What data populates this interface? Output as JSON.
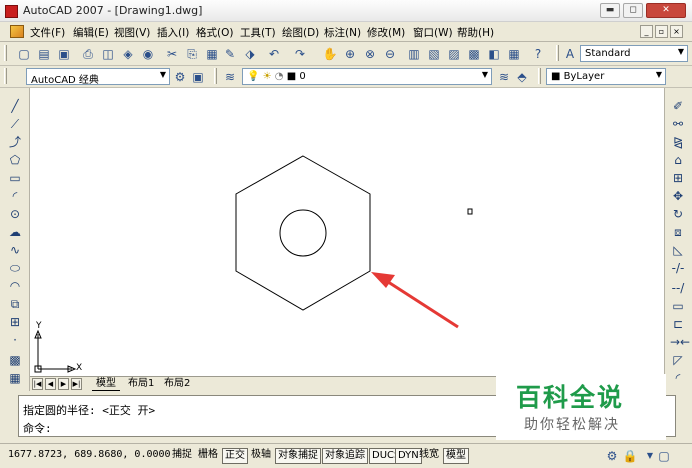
{
  "window": {
    "title": "AutoCAD 2007 - [Drawing1.dwg]",
    "controls": {
      "minimize": "▬",
      "maximize": "◻",
      "close": "✕"
    },
    "mdi": {
      "minimize": "_",
      "restore": "▫",
      "close": "×"
    }
  },
  "menu": {
    "items": [
      "文件(F)",
      "编辑(E)",
      "视图(V)",
      "插入(I)",
      "格式(O)",
      "工具(T)",
      "绘图(D)",
      "标注(N)",
      "修改(M)",
      "窗口(W)",
      "帮助(H)"
    ]
  },
  "toolbar": {
    "text_style": "Standard",
    "workspace": "AutoCAD 经典",
    "layer": "0",
    "color": "ByLayer"
  },
  "tabs": {
    "items": [
      "模型",
      "布局1",
      "布局2"
    ],
    "active": "模型"
  },
  "command": {
    "line1": "指定圆的半径: <正交 开>",
    "prompt": "命令:"
  },
  "status": {
    "coordinates": "1677.8723, 689.8680, 0.0000",
    "buttons": [
      "捕捉",
      "栅格",
      "正交",
      "极轴",
      "对象捕捉",
      "对象追踪",
      "DUCS",
      "DYN",
      "线宽",
      "模型"
    ],
    "on_buttons": [
      "正交",
      "对象捕捉",
      "对象追踪",
      "DUCS",
      "DYN",
      "模型"
    ]
  },
  "canvas": {
    "ucs_x": "X",
    "ucs_y": "Y"
  },
  "watermark": {
    "title": "百科全说",
    "subtitle": "助你轻松解决",
    "color": "#1f9b4a"
  },
  "colors": {
    "arrow": "#e53935",
    "canvas": "#ffffff",
    "chrome": "#ece9d8"
  }
}
